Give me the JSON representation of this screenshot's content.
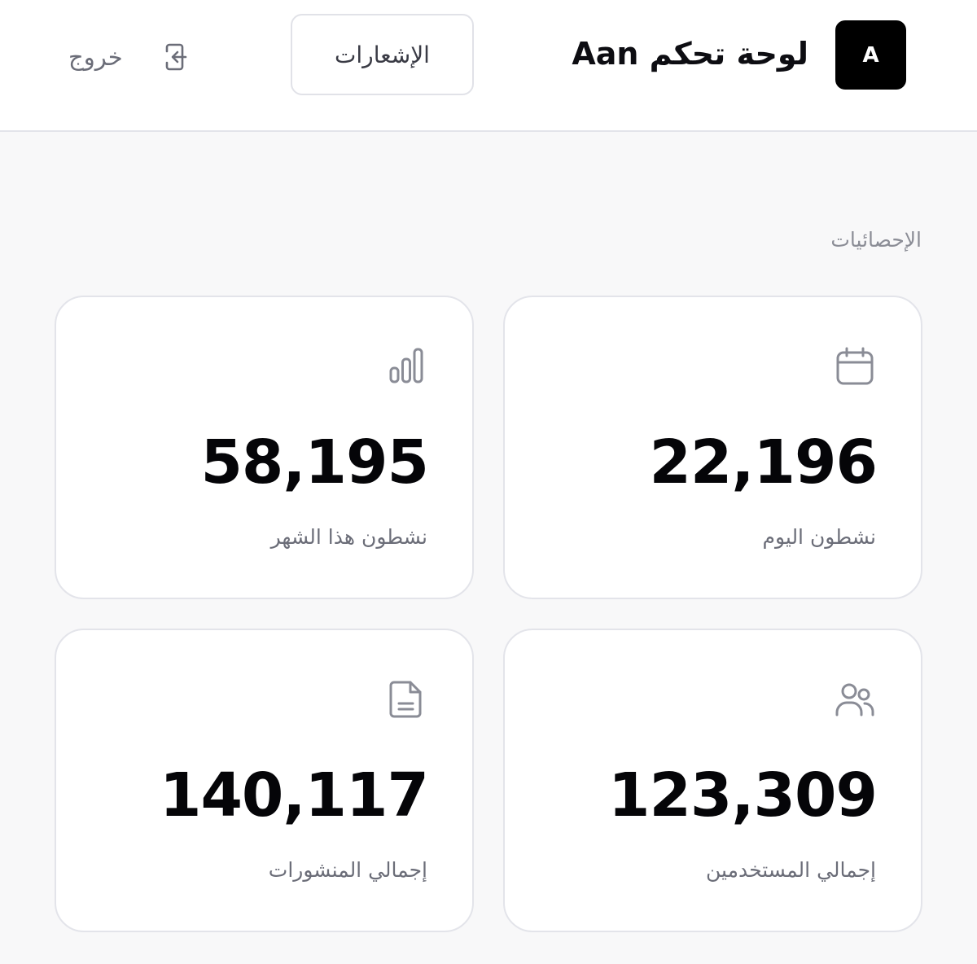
{
  "header": {
    "logo_letter": "A",
    "title": "لوحة تحكم Aan",
    "notifications_label": "الإشعارات",
    "logout_label": "خروج"
  },
  "stats": {
    "section_title": "الإحصائيات",
    "cards": [
      {
        "label": "نشطون اليوم",
        "value": "22,196",
        "icon": "calendar-icon"
      },
      {
        "label": "نشطون هذا الشهر",
        "value": "58,195",
        "icon": "bar-chart-icon"
      },
      {
        "label": "إجمالي المستخدمين",
        "value": "123,309",
        "icon": "users-icon"
      },
      {
        "label": "إجمالي المنشورات",
        "value": "140,117",
        "icon": "document-icon"
      }
    ]
  },
  "colors": {
    "background": "#f8f8f9",
    "card_border": "#e3e4ea",
    "muted_text": "#6b6d78",
    "icon_gray": "#8a8c96",
    "logo_bg": "#000000"
  }
}
